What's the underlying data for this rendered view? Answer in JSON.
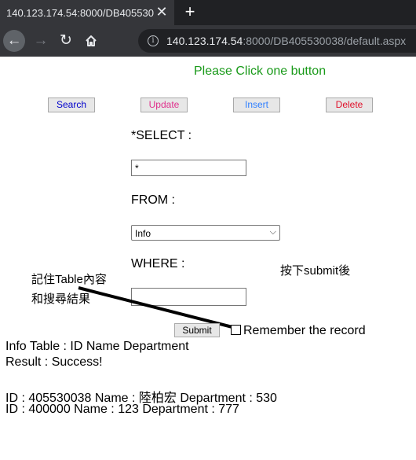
{
  "browser": {
    "tab_title": "140.123.174.54:8000/DB4055300",
    "close_glyph": "✕",
    "new_tab_glyph": "+",
    "url_host": "140.123.174.54",
    "url_rest": ":8000/DB405530038/default.aspx",
    "icons": {
      "back": "arrow-left-icon",
      "forward": "arrow-right-icon",
      "reload": "reload-icon",
      "home": "home-icon",
      "info": "info-icon"
    }
  },
  "page": {
    "heading": "Please Click one button",
    "buttons": {
      "search": "Search",
      "update": "Update",
      "insert": "Insert",
      "delete": "Delete"
    },
    "button_colors": {
      "search": "#0000cc",
      "update": "#e0308c",
      "insert": "#2f7fff",
      "delete": "#e0102a"
    },
    "select_label": "*SELECT :",
    "select_value": "*",
    "from_label": "FROM :",
    "from_value": "Info",
    "where_label": "WHERE :",
    "where_value": "",
    "submit_label": "Submit",
    "remember_label": "Remember the record",
    "annotation_left_line1": "記住Table內容",
    "annotation_left_line2": "和搜尋結果",
    "annotation_right": "按下submit後",
    "table_info": "Info Table : ID Name Department",
    "result": "Result : Success!",
    "rows": [
      "ID : 405530038 Name : 陸柏宏 Department : 530",
      "ID : 400000 Name : 123 Department : 777"
    ]
  }
}
